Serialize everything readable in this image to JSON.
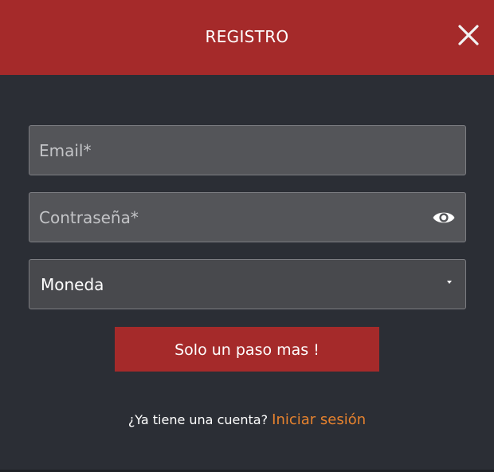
{
  "header": {
    "title": "REGISTRO",
    "close_icon": "close-icon"
  },
  "form": {
    "email": {
      "value": "",
      "placeholder": "Email*"
    },
    "password": {
      "value": "",
      "placeholder": "Contraseña*",
      "toggle_icon": "eye-icon"
    },
    "currency": {
      "selected": "Moneda",
      "caret_icon": "caret-down-icon"
    },
    "submit_label": "Solo un paso mas !"
  },
  "footer": {
    "prompt": "¿Ya tiene una cuenta?",
    "login_link": "Iniciar sesión"
  },
  "colors": {
    "header_bg": "#a52a2a",
    "body_bg": "#2b2e35",
    "field_bg": "#545559",
    "button_bg": "#a52a2a",
    "link": "#e6822e"
  }
}
